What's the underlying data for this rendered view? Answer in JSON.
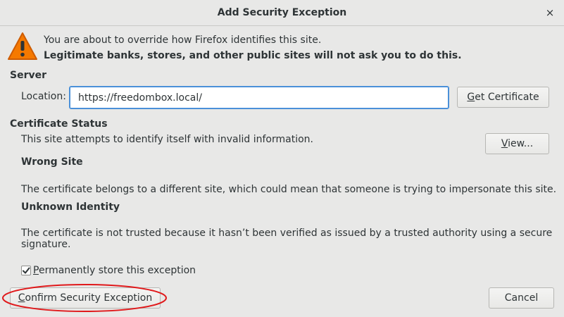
{
  "dialog": {
    "title": "Add Security Exception",
    "close_glyph": "×"
  },
  "intro": {
    "line1": "You are about to override how Firefox identifies this site.",
    "line2": "Legitimate banks, stores, and other public sites will not ask you to do this."
  },
  "server": {
    "heading": "Server",
    "location_label": "Location:",
    "location_value": "https://freedombox.local/",
    "get_certificate_mnemonic": "G",
    "get_certificate_rest": "et Certificate"
  },
  "status": {
    "heading": "Certificate Status",
    "summary": "This site attempts to identify itself with invalid information.",
    "view_mnemonic": "V",
    "view_rest": "iew...",
    "wrong_site_title": "Wrong Site",
    "wrong_site_text": "The certificate belongs to a different site, which could mean that someone is trying to impersonate this site.",
    "unknown_identity_title": "Unknown Identity",
    "unknown_identity_text": "The certificate is not trusted because it hasn’t been verified as issued by a trusted authority using a secure signature."
  },
  "footer": {
    "permanent_mnemonic": "P",
    "permanent_rest": "ermanently store this exception",
    "permanent_checked": true,
    "confirm_mnemonic": "C",
    "confirm_rest": "onfirm Security Exception",
    "cancel_label": "Cancel"
  },
  "colors": {
    "background": "#e8e8e7",
    "focus_border": "#4a90d9",
    "annotation_oval": "#e0191b",
    "warning_fill": "#f57900",
    "text": "#2e3436"
  },
  "icons": {
    "warning": "warning-triangle-icon",
    "close": "close-icon",
    "checkmark": "checkmark-icon"
  }
}
